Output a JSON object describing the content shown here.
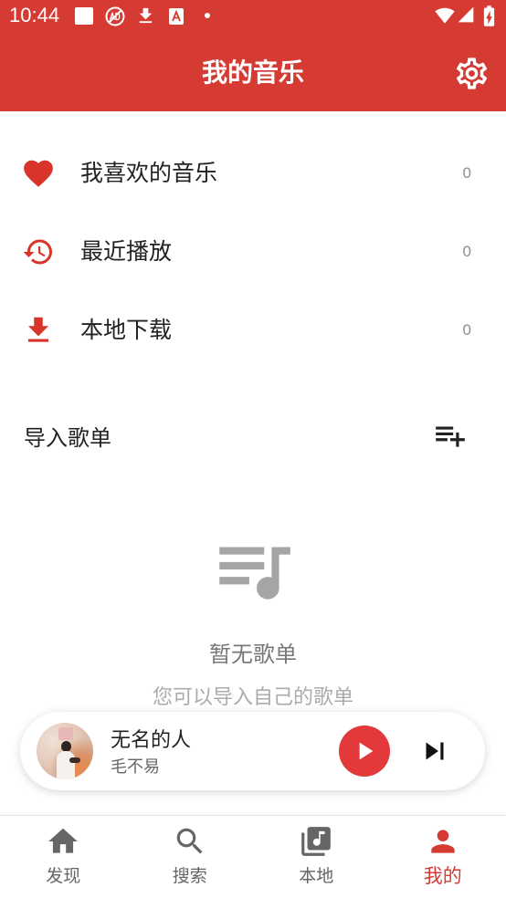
{
  "status_bar": {
    "time": "10:44",
    "left_icons": [
      "square-icon",
      "circle-slash-icon",
      "download-arrow-icon",
      "letter-a-box-icon",
      "dot-icon"
    ],
    "right_icons": [
      "wifi-icon",
      "signal-icon",
      "battery-charging-icon"
    ]
  },
  "header": {
    "title": "我的音乐",
    "action_icon": "gear-icon"
  },
  "library": {
    "items": [
      {
        "label": "我喜欢的音乐",
        "count": "0",
        "icon": "heart-icon"
      },
      {
        "label": "最近播放",
        "count": "0",
        "icon": "history-icon"
      },
      {
        "label": "本地下载",
        "count": "0",
        "icon": "download-icon"
      }
    ]
  },
  "playlists": {
    "title": "导入歌单",
    "action_icon": "playlist-add-icon",
    "empty_icon": "queue-music-icon",
    "empty_title": "暂无歌单",
    "empty_hint": "您可以导入自己的歌单"
  },
  "player": {
    "title": "无名的人",
    "artist": "毛不易",
    "play_icon": "play-icon",
    "next_icon": "skip-next-icon"
  },
  "nav": {
    "items": [
      {
        "label": "发现",
        "icon": "home-icon",
        "active": false
      },
      {
        "label": "搜索",
        "icon": "search-icon",
        "active": false
      },
      {
        "label": "本地",
        "icon": "library-music-icon",
        "active": false
      },
      {
        "label": "我的",
        "icon": "person-icon",
        "active": true
      }
    ]
  },
  "colors": {
    "accent": "#D53A33",
    "play_button": "#E3393A",
    "text_primary": "#222222",
    "text_secondary": "#666666",
    "muted_icon": "#A5A5A5",
    "nav_inactive": "#666666"
  }
}
